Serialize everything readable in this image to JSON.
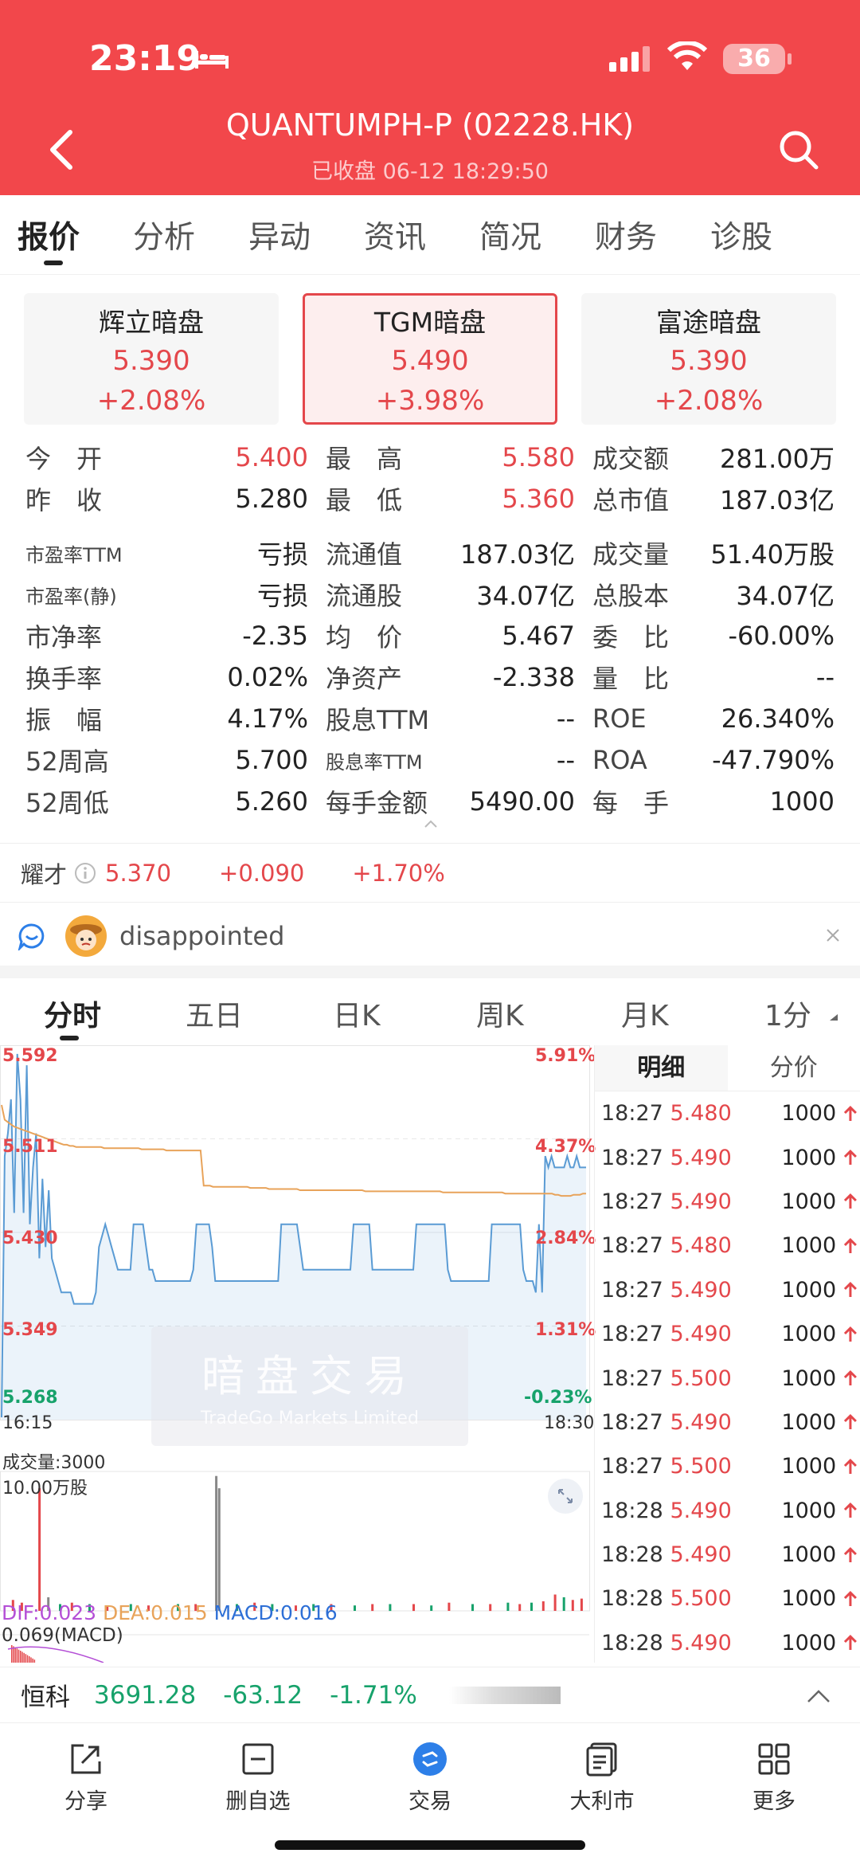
{
  "status": {
    "time": "23:19",
    "battery": "36"
  },
  "header": {
    "title": "QUANTUMPH-P (02228.HK)",
    "subtitle": "已收盘 06-12 18:29:50"
  },
  "tabs": [
    "报价",
    "分析",
    "异动",
    "资讯",
    "简况",
    "财务",
    "诊股"
  ],
  "darkpools": [
    {
      "name": "辉立暗盘",
      "price": "5.390",
      "change": "+2.08%"
    },
    {
      "name": "TGM暗盘",
      "price": "5.490",
      "change": "+3.98%",
      "selected": true
    },
    {
      "name": "富途暗盘",
      "price": "5.390",
      "change": "+2.08%"
    }
  ],
  "stats": [
    [
      "今　开",
      "5.400",
      "最　高",
      "5.580",
      "成交额",
      "281.00万"
    ],
    [
      "昨　收",
      "5.280",
      "最　低",
      "5.360",
      "总市值",
      "187.03亿"
    ],
    [
      "市盈率TTM",
      "亏损",
      "流通值",
      "187.03亿",
      "成交量",
      "51.40万股"
    ],
    [
      "市盈率(静)",
      "亏损",
      "流通股",
      "34.07亿",
      "总股本",
      "34.07亿"
    ],
    [
      "市净率",
      "-2.35",
      "均　价",
      "5.467",
      "委　比",
      "-60.00%"
    ],
    [
      "换手率",
      "0.02%",
      "净资产",
      "-2.338",
      "量　比",
      "--"
    ],
    [
      "振　幅",
      "4.17%",
      "股息TTM",
      "--",
      "ROE",
      "26.340%"
    ],
    [
      "52周高",
      "5.700",
      "股息率TTM",
      "--",
      "ROA",
      "-47.790%"
    ],
    [
      "52周低",
      "5.260",
      "每手金额",
      "5490.00",
      "每　手",
      "1000"
    ]
  ],
  "yaocai": {
    "label": "耀才",
    "price": "5.370",
    "change": "+0.090",
    "pct": "+1.70%"
  },
  "notice": {
    "text": "disappointed"
  },
  "chart_tabs": [
    "分时",
    "五日",
    "日K",
    "周K",
    "月K",
    "1分"
  ],
  "chart_data": {
    "type": "line",
    "title": "",
    "x_range": [
      "16:15",
      "18:30"
    ],
    "y_ticks": [
      "5.592",
      "5.511",
      "5.430",
      "5.349",
      "5.268"
    ],
    "y_pct_ticks": [
      "5.91%",
      "4.37%",
      "2.84%",
      "1.31%",
      "-0.23%"
    ],
    "ylim": [
      5.268,
      5.592
    ],
    "series": [
      {
        "values": [
          5.27,
          5.5,
          5.52,
          5.55,
          5.45,
          5.59,
          5.55,
          5.45,
          5.58,
          5.44,
          5.49,
          5.52,
          5.41,
          5.48,
          5.42,
          5.47,
          5.41,
          5.4,
          5.39,
          5.38,
          5.38,
          5.38,
          5.38,
          5.37,
          5.37,
          5.37,
          5.37,
          5.37,
          5.37,
          5.37,
          5.38,
          5.42,
          5.43,
          5.44,
          5.43,
          5.42,
          5.41,
          5.4,
          5.4,
          5.4,
          5.4,
          5.4,
          5.44,
          5.44,
          5.44,
          5.44,
          5.42,
          5.4,
          5.4,
          5.39,
          5.39,
          5.39,
          5.39,
          5.39,
          5.39,
          5.39,
          5.39,
          5.39,
          5.39,
          5.39,
          5.39,
          5.4,
          5.44,
          5.44,
          5.44,
          5.44,
          5.44,
          5.42,
          5.39,
          5.39,
          5.39,
          5.39,
          5.39,
          5.39,
          5.39,
          5.39,
          5.39,
          5.39,
          5.39,
          5.39,
          5.39,
          5.39,
          5.39,
          5.39,
          5.39,
          5.39,
          5.39,
          5.39,
          5.39,
          5.44,
          5.44,
          5.44,
          5.44,
          5.44,
          5.44,
          5.42,
          5.4,
          5.4,
          5.4,
          5.4,
          5.4,
          5.4,
          5.4,
          5.4,
          5.4,
          5.4,
          5.4,
          5.4,
          5.4,
          5.4,
          5.4,
          5.4,
          5.44,
          5.44,
          5.44,
          5.44,
          5.44,
          5.44,
          5.4,
          5.4,
          5.4,
          5.4,
          5.4,
          5.4,
          5.4,
          5.4,
          5.4,
          5.4,
          5.4,
          5.4,
          5.4,
          5.4,
          5.44,
          5.44,
          5.44,
          5.44,
          5.44,
          5.44,
          5.44,
          5.44,
          5.44,
          5.44,
          5.4,
          5.39,
          5.39,
          5.39,
          5.39,
          5.39,
          5.39,
          5.39,
          5.39,
          5.39,
          5.39,
          5.39,
          5.39,
          5.39,
          5.44,
          5.44,
          5.44,
          5.44,
          5.44,
          5.44,
          5.44,
          5.44,
          5.44,
          5.44,
          5.4,
          5.39,
          5.39,
          5.39,
          5.38,
          5.44,
          5.38,
          5.5,
          5.49,
          5.5,
          5.49,
          5.49,
          5.49,
          5.49,
          5.5,
          5.49,
          5.49,
          5.5,
          5.49,
          5.49,
          5.49
        ]
      },
      {
        "values": [
          5.545,
          5.532,
          5.53,
          5.528,
          5.526,
          5.525,
          5.524,
          5.523,
          5.522,
          5.521,
          5.52,
          5.519,
          5.518,
          5.517,
          5.516,
          5.515,
          5.514,
          5.513,
          5.512,
          5.511,
          5.51,
          5.51,
          5.509,
          5.509,
          5.508,
          5.508,
          5.508,
          5.508,
          5.508,
          5.508,
          5.508,
          5.508,
          5.508,
          5.507,
          5.507,
          5.507,
          5.507,
          5.507,
          5.507,
          5.507,
          5.507,
          5.507,
          5.507,
          5.507,
          5.507,
          5.506,
          5.506,
          5.506,
          5.506,
          5.506,
          5.506,
          5.506,
          5.506,
          5.505,
          5.505,
          5.505,
          5.505,
          5.505,
          5.505,
          5.505,
          5.505,
          5.505,
          5.505,
          5.505,
          5.505,
          5.474,
          5.474,
          5.474,
          5.473,
          5.473,
          5.473,
          5.473,
          5.473,
          5.473,
          5.473,
          5.473,
          5.473,
          5.473,
          5.473,
          5.473,
          5.472,
          5.472,
          5.472,
          5.472,
          5.472,
          5.472,
          5.471,
          5.471,
          5.471,
          5.471,
          5.471,
          5.471,
          5.471,
          5.471,
          5.471,
          5.471,
          5.47,
          5.47,
          5.47,
          5.47,
          5.47,
          5.47,
          5.47,
          5.47,
          5.47,
          5.47,
          5.47,
          5.47,
          5.47,
          5.47,
          5.47,
          5.47,
          5.47,
          5.47,
          5.47,
          5.47,
          5.47,
          5.469,
          5.469,
          5.469,
          5.469,
          5.469,
          5.469,
          5.469,
          5.469,
          5.469,
          5.469,
          5.469,
          5.469,
          5.469,
          5.469,
          5.469,
          5.469,
          5.469,
          5.469,
          5.469,
          5.469,
          5.469,
          5.469,
          5.469,
          5.469,
          5.469,
          5.468,
          5.468,
          5.468,
          5.468,
          5.468,
          5.468,
          5.468,
          5.468,
          5.468,
          5.468,
          5.468,
          5.468,
          5.468,
          5.468,
          5.468,
          5.468,
          5.468,
          5.468,
          5.468,
          5.468,
          5.467,
          5.467,
          5.467,
          5.467,
          5.467,
          5.467,
          5.467,
          5.467,
          5.467,
          5.467,
          5.467,
          5.467,
          5.467,
          5.467,
          5.467,
          5.467,
          5.466,
          5.466,
          5.465,
          5.465,
          5.465,
          5.465,
          5.466,
          5.466,
          5.466,
          5.467,
          5.467
        ]
      }
    ],
    "volume": {
      "label": "成交量:3000",
      "unit": "10.00万股",
      "bars": [
        {
          "x": 0.02,
          "v": 0.08,
          "c": "red"
        },
        {
          "x": 0.035,
          "v": 0.06,
          "c": "red"
        },
        {
          "x": 0.065,
          "v": 0.9,
          "c": "red"
        },
        {
          "x": 0.08,
          "v": 0.1,
          "c": "gray"
        },
        {
          "x": 0.1,
          "v": 0.05,
          "c": "green"
        },
        {
          "x": 0.12,
          "v": 0.06,
          "c": "red"
        },
        {
          "x": 0.15,
          "v": 0.05,
          "c": "green"
        },
        {
          "x": 0.18,
          "v": 0.04,
          "c": "red"
        },
        {
          "x": 0.22,
          "v": 0.05,
          "c": "green"
        },
        {
          "x": 0.25,
          "v": 0.04,
          "c": "red"
        },
        {
          "x": 0.3,
          "v": 0.05,
          "c": "green"
        },
        {
          "x": 0.33,
          "v": 0.05,
          "c": "red"
        },
        {
          "x": 0.365,
          "v": 0.99,
          "c": "gray"
        },
        {
          "x": 0.37,
          "v": 0.9,
          "c": "gray"
        },
        {
          "x": 0.4,
          "v": 0.05,
          "c": "green"
        },
        {
          "x": 0.43,
          "v": 0.06,
          "c": "red"
        },
        {
          "x": 0.46,
          "v": 0.05,
          "c": "green"
        },
        {
          "x": 0.5,
          "v": 0.04,
          "c": "red"
        },
        {
          "x": 0.53,
          "v": 0.05,
          "c": "green"
        },
        {
          "x": 0.56,
          "v": 0.05,
          "c": "red"
        },
        {
          "x": 0.6,
          "v": 0.04,
          "c": "green"
        },
        {
          "x": 0.63,
          "v": 0.05,
          "c": "red"
        },
        {
          "x": 0.66,
          "v": 0.05,
          "c": "green"
        },
        {
          "x": 0.7,
          "v": 0.05,
          "c": "red"
        },
        {
          "x": 0.73,
          "v": 0.04,
          "c": "green"
        },
        {
          "x": 0.76,
          "v": 0.06,
          "c": "red"
        },
        {
          "x": 0.8,
          "v": 0.05,
          "c": "green"
        },
        {
          "x": 0.83,
          "v": 0.05,
          "c": "red"
        },
        {
          "x": 0.86,
          "v": 0.06,
          "c": "green"
        },
        {
          "x": 0.88,
          "v": 0.05,
          "c": "red"
        },
        {
          "x": 0.9,
          "v": 0.06,
          "c": "green"
        },
        {
          "x": 0.92,
          "v": 0.07,
          "c": "red"
        },
        {
          "x": 0.94,
          "v": 0.12,
          "c": "red"
        },
        {
          "x": 0.955,
          "v": 0.1,
          "c": "green"
        },
        {
          "x": 0.97,
          "v": 0.08,
          "c": "red"
        },
        {
          "x": 0.985,
          "v": 0.09,
          "c": "red"
        }
      ]
    },
    "macd": {
      "dif": "DIF:0.023",
      "dea": "DEA:0.015",
      "macd": "MACD:0.016",
      "scale": "0.069(MACD)"
    }
  },
  "watermark": {
    "main": "暗盘交易",
    "sub": "TradeGo Markets Limited"
  },
  "time_labels": {
    "start": "16:15",
    "end": "18:30"
  },
  "detail": {
    "tabs": [
      "明细",
      "分价"
    ],
    "rows": [
      [
        "18:27",
        "5.480",
        "1000"
      ],
      [
        "18:27",
        "5.490",
        "1000"
      ],
      [
        "18:27",
        "5.490",
        "1000"
      ],
      [
        "18:27",
        "5.480",
        "1000"
      ],
      [
        "18:27",
        "5.490",
        "1000"
      ],
      [
        "18:27",
        "5.490",
        "1000"
      ],
      [
        "18:27",
        "5.500",
        "1000"
      ],
      [
        "18:27",
        "5.490",
        "1000"
      ],
      [
        "18:27",
        "5.500",
        "1000"
      ],
      [
        "18:28",
        "5.490",
        "1000"
      ],
      [
        "18:28",
        "5.490",
        "1000"
      ],
      [
        "18:28",
        "5.500",
        "1000"
      ],
      [
        "18:28",
        "5.490",
        "1000"
      ]
    ]
  },
  "index": {
    "name": "恒科",
    "value": "3691.28",
    "change": "-63.12",
    "pct": "-1.71%"
  },
  "nav": [
    {
      "label": "分享",
      "icon": "share-icon"
    },
    {
      "label": "删自选",
      "icon": "remove-watchlist-icon"
    },
    {
      "label": "交易",
      "icon": "trade-icon"
    },
    {
      "label": "大利市",
      "icon": "dalishi-icon"
    },
    {
      "label": "更多",
      "icon": "more-grid-icon"
    }
  ],
  "colors": {
    "brand": "#f2474b",
    "up": "#e4474b",
    "down": "#17a26b",
    "price_line": "#5a9bd4",
    "avg_line": "#e8a35a"
  }
}
